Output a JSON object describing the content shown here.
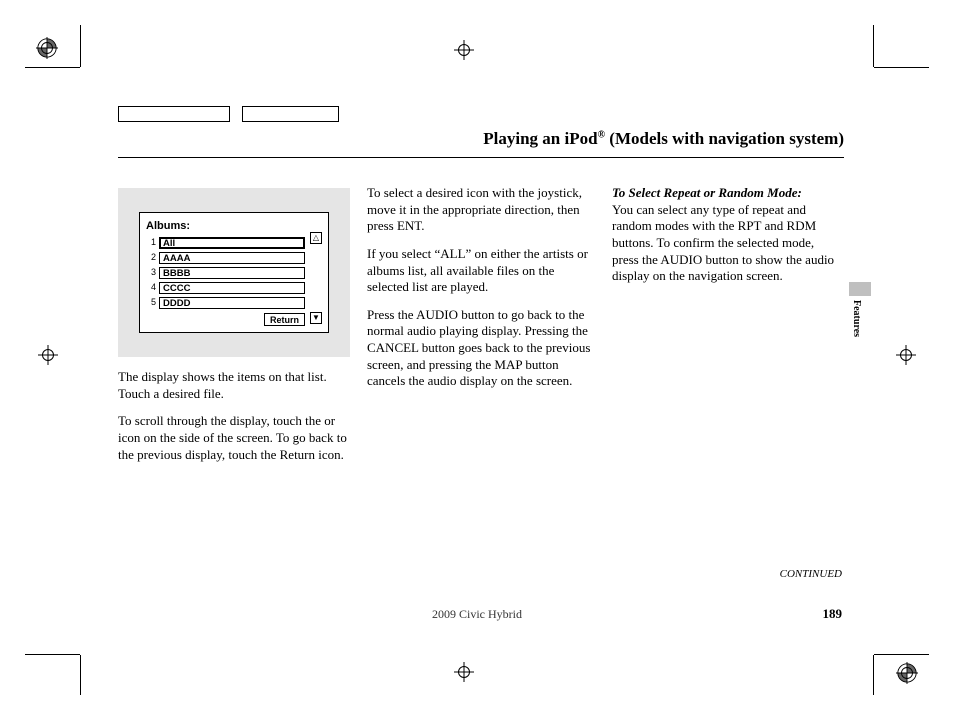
{
  "title_pre": "Playing an iPod",
  "title_sup": "®",
  "title_post": " (Models with navigation system)",
  "features_label": "Features",
  "illustration": {
    "heading": "Albums:",
    "rows": [
      {
        "n": "1",
        "label": "All",
        "selected": true
      },
      {
        "n": "2",
        "label": "AAAA",
        "selected": false
      },
      {
        "n": "3",
        "label": "BBBB",
        "selected": false
      },
      {
        "n": "4",
        "label": "CCCC",
        "selected": false
      },
      {
        "n": "5",
        "label": "DDDD",
        "selected": false
      }
    ],
    "return_label": "Return",
    "scroll_up": "△",
    "scroll_down": "▼"
  },
  "col1": {
    "p1": "The display shows the items on that list. Touch a desired file.",
    "p2": "To scroll through the display, touch the      or      icon on the side of the screen. To go back to the previous display, touch the Return icon."
  },
  "col2": {
    "p1": "To select a desired icon with the joystick, move it in the appropriate direction, then press ENT.",
    "p2": "If you select “ALL” on either the artists or albums list, all available files on the selected list are played.",
    "p3": "Press the AUDIO button to go back to the normal audio playing display. Pressing the CANCEL button goes back to the previous screen, and pressing the MAP button cancels the audio display on the screen."
  },
  "col3": {
    "heading": "To Select Repeat or Random Mode:",
    "p1": "You can select any type of repeat and random modes with the RPT and RDM buttons. To confirm the selected mode, press the AUDIO button to show the audio display on the navigation screen."
  },
  "continued": "CONTINUED",
  "footer_model": "2009  Civic  Hybrid",
  "page_number": "189"
}
